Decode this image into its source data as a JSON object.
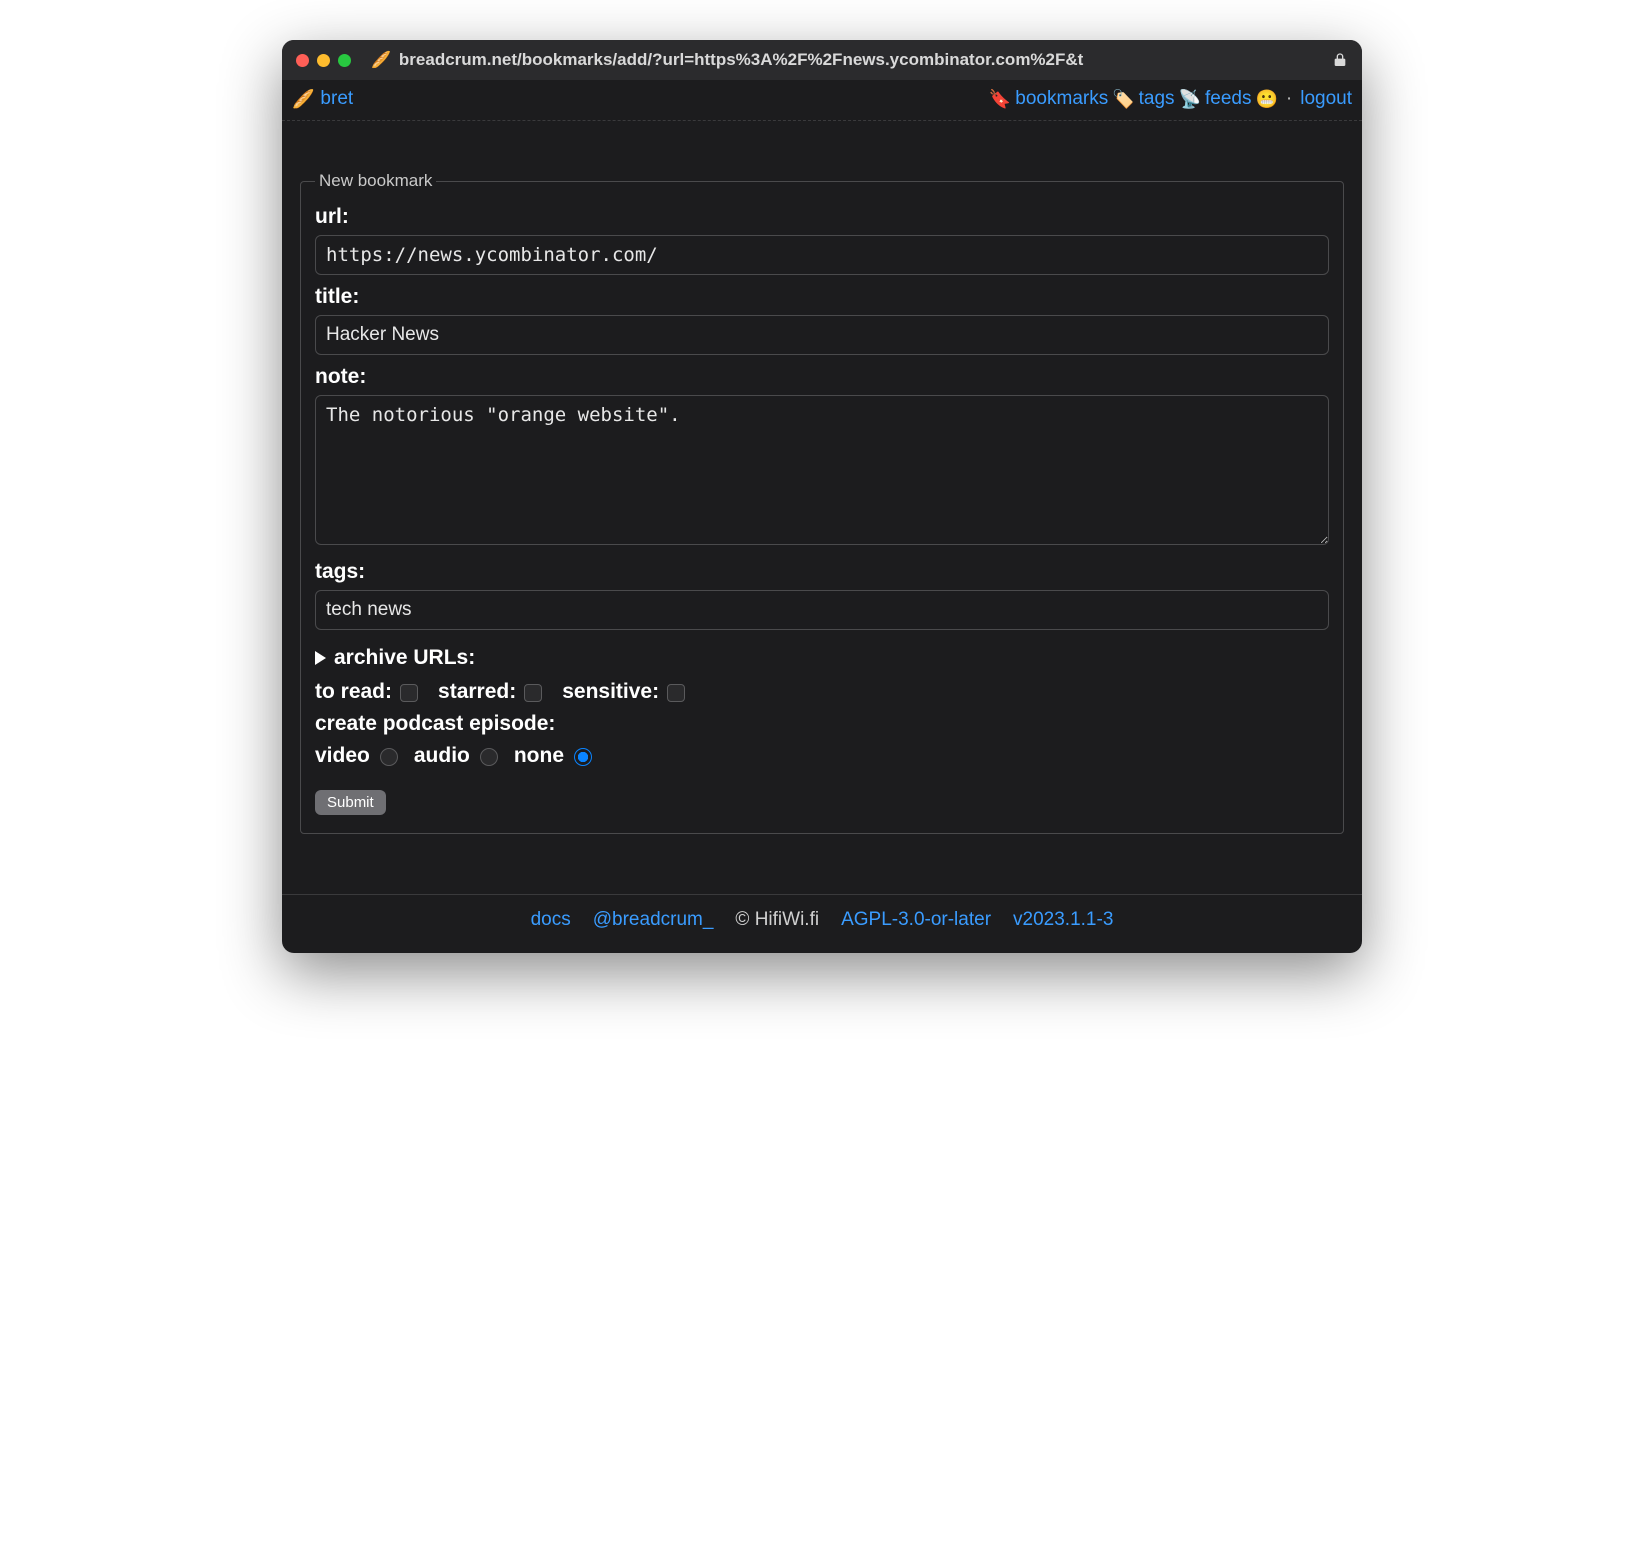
{
  "window": {
    "title_icon": "🥖",
    "title": "breadcrum.net/bookmarks/add/?url=https%3A%2F%2Fnews.ycombinator.com%2F&t"
  },
  "header": {
    "logo_icon": "🥖",
    "username": "bret",
    "nav": {
      "bookmarks": {
        "icon": "🔖",
        "label": "bookmarks"
      },
      "tags": {
        "icon": "🏷️",
        "label": "tags"
      },
      "feeds": {
        "icon": "📡",
        "label": "feeds"
      },
      "admin_icon": "😬",
      "logout_label": "logout"
    }
  },
  "form": {
    "legend": "New bookmark",
    "url_label": "url:",
    "url_value": "https://news.ycombinator.com/",
    "title_label": "title:",
    "title_value": "Hacker News",
    "note_label": "note:",
    "note_value": "The notorious \"orange website\".",
    "tags_label": "tags:",
    "tags_value": "tech news",
    "archive_label": "archive URLs:",
    "toread_label": "to read:",
    "starred_label": "starred:",
    "sensitive_label": "sensitive:",
    "podcast_label": "create podcast episode:",
    "podcast_options": {
      "video": "video",
      "audio": "audio",
      "none": "none"
    },
    "podcast_selected": "none",
    "submit_label": "Submit"
  },
  "footer": {
    "docs": "docs",
    "handle": "@breadcrum_",
    "copyright": "© HifiWi.fi",
    "license": "AGPL-3.0-or-later",
    "version": "v2023.1.1-3"
  }
}
